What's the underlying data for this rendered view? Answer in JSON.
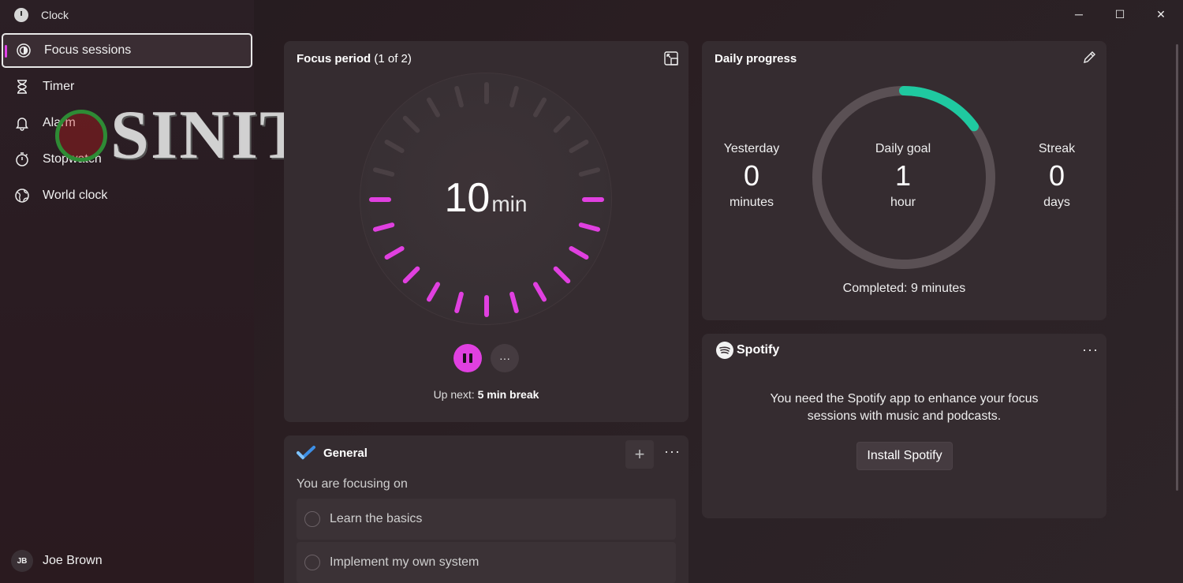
{
  "app": {
    "title": "Clock",
    "icon": "clock-app-icon"
  },
  "window_controls": {
    "minimize": "─",
    "maximize": "☐",
    "close": "✕"
  },
  "sidebar": {
    "items": [
      {
        "label": "Focus sessions",
        "icon": "focus-icon",
        "active": true
      },
      {
        "label": "Timer",
        "icon": "hourglass-icon",
        "active": false
      },
      {
        "label": "Alarm",
        "icon": "bell-icon",
        "active": false
      },
      {
        "label": "Stopwatch",
        "icon": "stopwatch-icon",
        "active": false
      },
      {
        "label": "World clock",
        "icon": "globe-icon",
        "active": false
      }
    ],
    "user": {
      "initials": "JB",
      "name": "Joe Brown"
    }
  },
  "watermark": {
    "text": "SINITC"
  },
  "focus": {
    "title_bold": "Focus period",
    "title_light": " (1 of 2)",
    "value": "10",
    "unit": "min",
    "remaining_fraction": 0.5,
    "accent_color": "#e040e0",
    "more_label": "···",
    "upnext_label": "Up next:",
    "upnext_value": "5 min break"
  },
  "daily": {
    "title": "Daily progress",
    "yesterday": {
      "label": "Yesterday",
      "value": "0",
      "unit": "minutes"
    },
    "goal": {
      "label": "Daily goal",
      "value": "1",
      "unit": "hour"
    },
    "streak": {
      "label": "Streak",
      "value": "0",
      "unit": "days"
    },
    "progress_fraction": 0.15,
    "progress_color": "#1fc9a0",
    "completed": "Completed: 9 minutes"
  },
  "spotify": {
    "name": "Spotify",
    "message": "You need the Spotify app to enhance your focus sessions with music and podcasts.",
    "install_label": "Install Spotify",
    "more_label": "···"
  },
  "general": {
    "title": "General",
    "add_label": "+",
    "more_label": "···",
    "focusing_label": "You are focusing on",
    "tasks": [
      {
        "label": "Learn the basics"
      },
      {
        "label": "Implement my own system"
      }
    ]
  }
}
